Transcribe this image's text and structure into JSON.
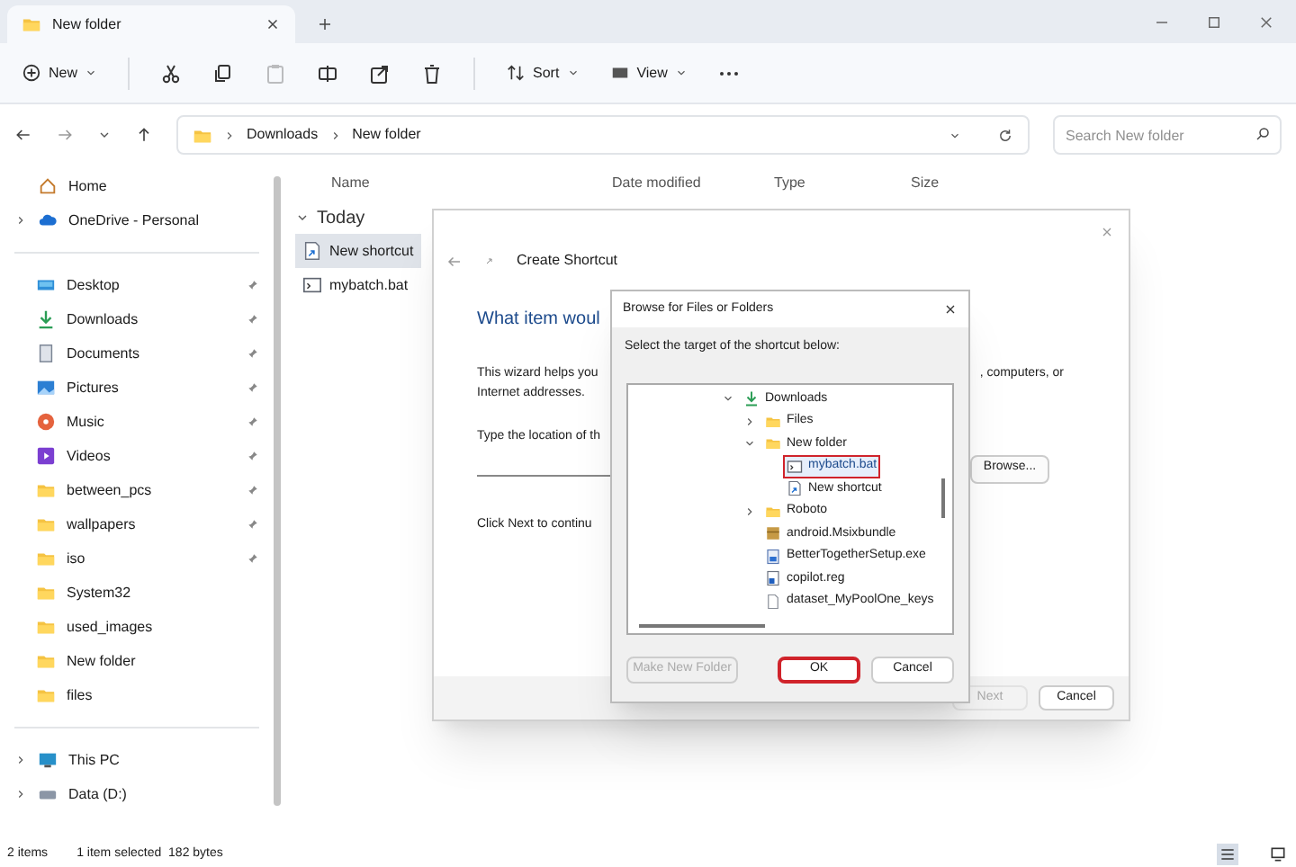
{
  "tab": {
    "title": "New folder"
  },
  "toolbar": {
    "new": "New",
    "actions": [
      {
        "kind": "cut",
        "disabled": false
      },
      {
        "kind": "copy",
        "disabled": false
      },
      {
        "kind": "paste",
        "disabled": true
      },
      {
        "kind": "rename",
        "disabled": false
      },
      {
        "kind": "share",
        "disabled": false
      },
      {
        "kind": "delete",
        "disabled": false
      }
    ],
    "sort": "Sort",
    "view": "View"
  },
  "address": {
    "path": [
      "Downloads",
      "New folder"
    ],
    "search_placeholder": "Search New folder"
  },
  "sidebar": {
    "groups": [
      [
        {
          "label": "Home",
          "kind": "home"
        },
        {
          "label": "OneDrive - Personal",
          "kind": "cloud",
          "expanded": false
        }
      ],
      [
        {
          "label": "Desktop",
          "kind": "desktop",
          "pinned": true
        },
        {
          "label": "Downloads",
          "kind": "download",
          "pinned": true
        },
        {
          "label": "Documents",
          "kind": "documents",
          "pinned": true
        },
        {
          "label": "Pictures",
          "kind": "pictures",
          "pinned": true
        },
        {
          "label": "Music",
          "kind": "music",
          "pinned": true
        },
        {
          "label": "Videos",
          "kind": "videos",
          "pinned": true
        },
        {
          "label": "between_pcs",
          "kind": "folder",
          "pinned": true
        },
        {
          "label": "wallpapers",
          "kind": "folder",
          "pinned": true
        },
        {
          "label": "iso",
          "kind": "folder",
          "pinned": true
        },
        {
          "label": "System32",
          "kind": "folder",
          "pinned": false
        },
        {
          "label": "used_images",
          "kind": "folder",
          "pinned": false
        },
        {
          "label": "New folder",
          "kind": "folder",
          "pinned": false
        },
        {
          "label": "files",
          "kind": "folder",
          "pinned": false
        }
      ],
      [
        {
          "label": "This PC",
          "kind": "pc",
          "expanded": false
        },
        {
          "label": "Data (D:)",
          "kind": "drive",
          "expanded": false
        }
      ]
    ]
  },
  "columns": [
    "Name",
    "Date modified",
    "Type",
    "Size"
  ],
  "file_groups": [
    {
      "label": "Today",
      "expanded": true,
      "files": [
        {
          "name": "New shortcut",
          "kind": "shortcut",
          "selected": true
        },
        {
          "name": "mybatch.bat",
          "kind": "batch",
          "selected": false
        }
      ]
    }
  ],
  "status_bar": {
    "count": "2 items",
    "selection": "1 item selected  182 bytes",
    "views": [
      {
        "kind": "details",
        "selected": true
      },
      {
        "kind": "tiles",
        "selected": false
      }
    ]
  },
  "wizard": {
    "title": "Create Shortcut",
    "heading": "What item woul",
    "intro_left": "This wizard helps you",
    "intro_right": ", computers, or",
    "intro_line2": "Internet addresses.",
    "field_label": "Type the location of th",
    "browse_button": "Browse...",
    "continue_text": "Click Next to continu",
    "buttons": [
      {
        "label": "Next",
        "disabled": true
      },
      {
        "label": "Cancel",
        "disabled": false
      }
    ]
  },
  "browse_dialog": {
    "title": "Browse for Files or Folders",
    "prompt": "Select the target of the shortcut below:",
    "tree": [
      {
        "label": "Downloads",
        "kind": "download",
        "expanded": true,
        "selected": false,
        "children": [
          {
            "label": "Files",
            "kind": "folder",
            "expanded": false,
            "selected": false
          },
          {
            "label": "New folder",
            "kind": "folder",
            "expanded": true,
            "selected": false,
            "children": [
              {
                "label": "mybatch.bat",
                "kind": "batch",
                "selected": true,
                "highlighted": true
              },
              {
                "label": "New shortcut",
                "kind": "shortcut",
                "selected": false,
                "highlighted": false
              }
            ]
          },
          {
            "label": "Roboto",
            "kind": "folder",
            "expanded": false,
            "selected": false
          },
          {
            "label": "android.Msixbundle",
            "kind": "package",
            "selected": false
          },
          {
            "label": "BetterTogetherSetup.exe",
            "kind": "installer",
            "selected": false
          },
          {
            "label": "copilot.reg",
            "kind": "registry",
            "selected": false
          },
          {
            "label": "dataset_MyPoolOne_keys",
            "kind": "file",
            "selected": false
          }
        ]
      }
    ],
    "buttons": [
      {
        "label": "Make New Folder",
        "disabled": true,
        "highlighted": false
      },
      {
        "label": "OK",
        "disabled": false,
        "highlighted": true
      },
      {
        "label": "Cancel",
        "disabled": false,
        "highlighted": false
      }
    ]
  }
}
